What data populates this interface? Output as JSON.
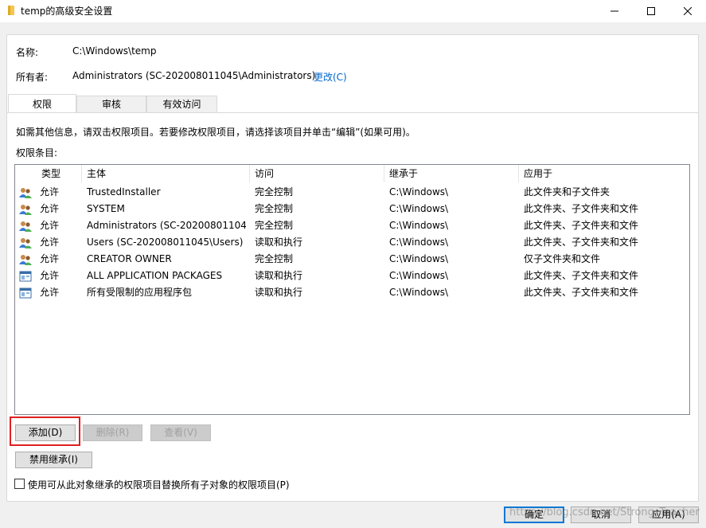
{
  "window": {
    "title": "temp的高级安全设置",
    "minimize_glyph": "—",
    "maximize_glyph": "☐",
    "close_glyph": "✕"
  },
  "info": {
    "name_label": "名称:",
    "name_value": "C:\\Windows\\temp",
    "owner_label": "所有者:",
    "owner_value": "Administrators (SC-202008011045\\Administrators)",
    "change_link": "更改(C)"
  },
  "tabs": [
    {
      "label": "权限",
      "active": true
    },
    {
      "label": "审核",
      "active": false
    },
    {
      "label": "有效访问",
      "active": false
    }
  ],
  "instructions": "如需其他信息，请双击权限项目。若要修改权限项目，请选择该项目并单击“编辑”(如果可用)。",
  "entries_label": "权限条目:",
  "table": {
    "columns": [
      "类型",
      "主体",
      "访问",
      "继承于",
      "应用于"
    ],
    "rows": [
      {
        "icon": "users-icon",
        "type": "允许",
        "principal": "TrustedInstaller",
        "access": "完全控制",
        "inherited": "C:\\Windows\\",
        "applies": "此文件夹和子文件夹"
      },
      {
        "icon": "users-icon",
        "type": "允许",
        "principal": "SYSTEM",
        "access": "完全控制",
        "inherited": "C:\\Windows\\",
        "applies": "此文件夹、子文件夹和文件"
      },
      {
        "icon": "users-icon",
        "type": "允许",
        "principal": "Administrators (SC-202008011045...",
        "access": "完全控制",
        "inherited": "C:\\Windows\\",
        "applies": "此文件夹、子文件夹和文件"
      },
      {
        "icon": "users-icon",
        "type": "允许",
        "principal": "Users (SC-202008011045\\Users)",
        "access": "读取和执行",
        "inherited": "C:\\Windows\\",
        "applies": "此文件夹、子文件夹和文件"
      },
      {
        "icon": "users-icon",
        "type": "允许",
        "principal": "CREATOR OWNER",
        "access": "完全控制",
        "inherited": "C:\\Windows\\",
        "applies": "仅子文件夹和文件"
      },
      {
        "icon": "app-package-icon",
        "type": "允许",
        "principal": "ALL APPLICATION PACKAGES",
        "access": "读取和执行",
        "inherited": "C:\\Windows\\",
        "applies": "此文件夹、子文件夹和文件"
      },
      {
        "icon": "app-package-icon",
        "type": "允许",
        "principal": "所有受限制的应用程序包",
        "access": "读取和执行",
        "inherited": "C:\\Windows\\",
        "applies": "此文件夹、子文件夹和文件"
      }
    ]
  },
  "buttons": {
    "add": "添加(D)",
    "remove": "删除(R)",
    "view": "查看(V)",
    "disable_inheritance": "禁用继承(I)",
    "ok": "确定",
    "cancel": "取消",
    "apply": "应用(A)"
  },
  "replace_checkbox_label": "使用可从此对象继承的权限项目替换所有子对象的权限项目(P)",
  "watermark": "https://blog.csdn.net/Strong_Teacher",
  "colors": {
    "link": "#0066cc",
    "highlight_border": "#e02020",
    "primary_border": "#0078d7"
  }
}
